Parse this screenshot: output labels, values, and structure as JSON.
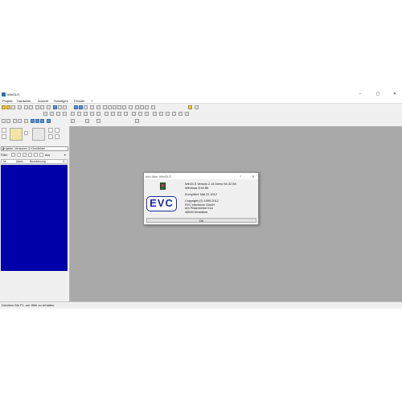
{
  "window": {
    "title": "WinOLS",
    "controls": {
      "minimize": "–",
      "maximize": "▢",
      "close": "✕"
    }
  },
  "menu": [
    "Projekt",
    "Hardware",
    "Ansicht",
    "Sonstiges",
    "Fenster",
    "?"
  ],
  "left_panel": {
    "combo_value": "Projekte, Versionen & Kennfelder",
    "filter_label": "Filter",
    "filter_text": "Aus",
    "columns": [
      "Nr",
      "Adres...",
      "Bezeichnung",
      "G"
    ]
  },
  "status_text": "Drücken Sie F1, um Hilfe zu erhalten.",
  "dialog": {
    "title": "Info über WinOLS",
    "help": "?",
    "close": "✕",
    "logo": "EVC",
    "line1": "WinOLS Version 2.14 Demo für 32 Bit",
    "line2": "Windows 8 64 Bit",
    "line3": "Kompiliert: Mai 22 2012",
    "line4": "Copyright (C) 1999-2012",
    "line5": "EVC electronic GmbH",
    "line6": "Am Pfaarrwinkel 11a",
    "line7": "46539 Dinslaken",
    "ok": "OK"
  }
}
